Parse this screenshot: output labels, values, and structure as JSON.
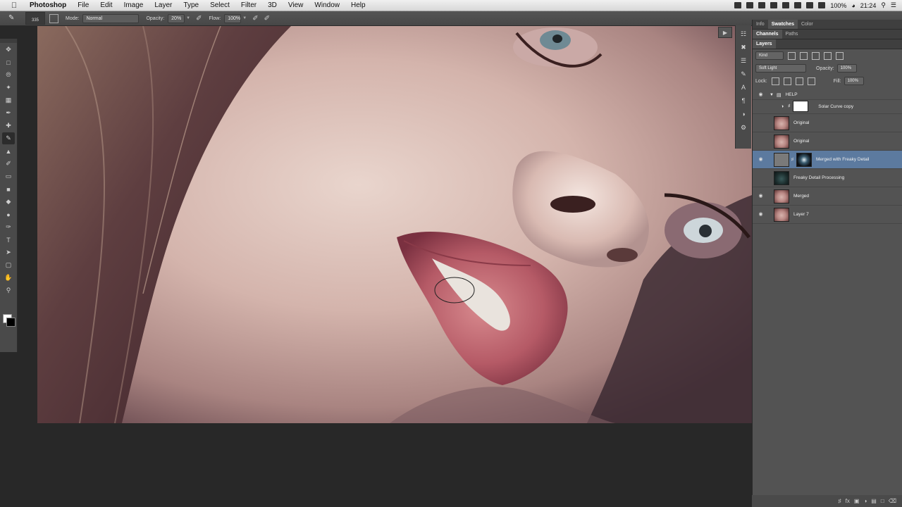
{
  "menubar": {
    "app_name": "Photoshop",
    "items": [
      "File",
      "Edit",
      "Image",
      "Layer",
      "Type",
      "Select",
      "Filter",
      "3D",
      "View",
      "Window",
      "Help"
    ],
    "battery": "100%",
    "clock": "21:24"
  },
  "options": {
    "brush_size": "335",
    "mode_label": "Mode:",
    "mode_value": "Normal",
    "opacity_label": "Opacity:",
    "opacity_value": "20%",
    "flow_label": "Flow:",
    "flow_value": "100%"
  },
  "panel_tabs_top": [
    "Info",
    "Swatches",
    "Color"
  ],
  "panel_tabs_mid": [
    "Channels",
    "Paths"
  ],
  "layers_panel": {
    "title": "Layers",
    "filter": "Kind",
    "blend_mode": "Soft Light",
    "opacity_label": "Opacity:",
    "opacity_value": "100%",
    "lock_label": "Lock:",
    "fill_label": "Fill:",
    "fill_value": "100%",
    "layers": [
      {
        "name": "HELP",
        "type": "group"
      },
      {
        "name": "Solar Curve copy",
        "type": "adjustment"
      },
      {
        "name": "Original",
        "type": "image"
      },
      {
        "name": "Original",
        "type": "image"
      },
      {
        "name": "Merged with Freaky Detail",
        "type": "masked",
        "selected": true
      },
      {
        "name": "Freaky Detail Processing",
        "type": "image"
      },
      {
        "name": "Merged",
        "type": "image"
      },
      {
        "name": "Layer 7",
        "type": "image"
      }
    ]
  },
  "colors": {
    "selected_layer": "#5c7a9f",
    "panel_bg": "#535353",
    "workspace_bg": "#282828"
  }
}
